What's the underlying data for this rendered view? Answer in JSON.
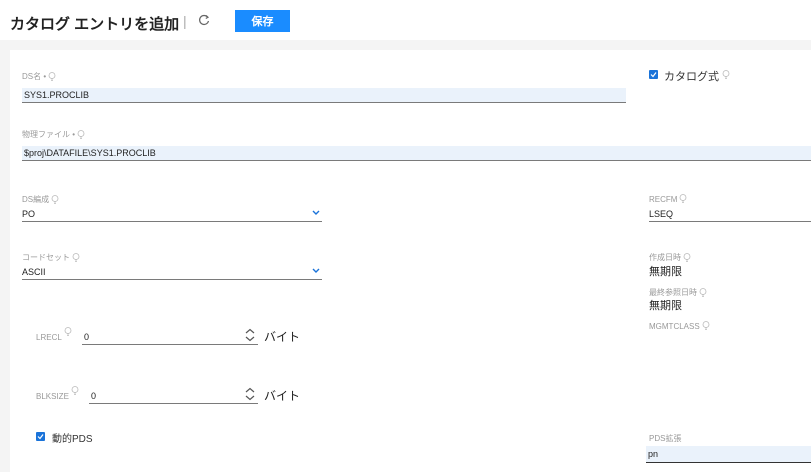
{
  "header": {
    "title": "カタログ エントリを追加",
    "separator": "|",
    "save_label": "保存"
  },
  "fields": {
    "ds_name": {
      "label": "DS名 •",
      "value": "SYS1.PROCLIB"
    },
    "catalog_type": {
      "label": "カタログ式",
      "checked": true
    },
    "physical_file": {
      "label": "物理ファイル •",
      "value": "$proj\\DATAFILE\\SYS1.PROCLIB"
    },
    "ds_org": {
      "label": "DS編成",
      "value": "PO"
    },
    "recfm": {
      "label": "RECFM",
      "value": "LSEQ"
    },
    "codeset": {
      "label": "コードセット",
      "value": "ASCII"
    },
    "created": {
      "label": "作成日時",
      "value": "無期限"
    },
    "last_ref": {
      "label": "最終参照日時",
      "value": "無期限"
    },
    "mgmtclass": {
      "label": "MGMTCLASS"
    },
    "lrecl": {
      "label": "LRECL",
      "value": "0",
      "unit": "バイト"
    },
    "blksize": {
      "label": "BLKSIZE",
      "value": "0",
      "unit": "バイト"
    },
    "dynamic_pds": {
      "label": "動的PDS",
      "checked": true
    },
    "pds_ext": {
      "label": "PDS拡張",
      "value": "pn"
    }
  },
  "colors": {
    "accent": "#1a8cff",
    "input_bg": "#eaf2fb"
  }
}
